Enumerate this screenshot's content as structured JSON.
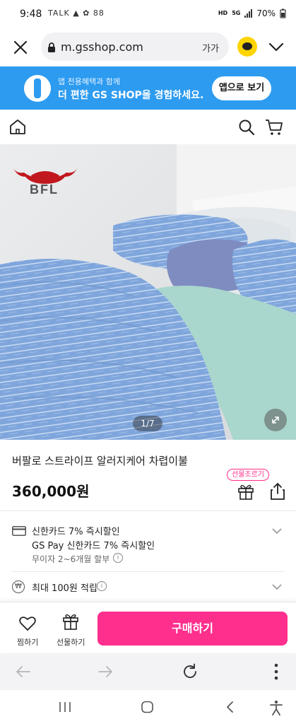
{
  "status_bar": {
    "time": "9:48",
    "left_icons_text": "TALK ▲ ✿ 88",
    "hd_label": "HD",
    "net_label": "5G",
    "battery": "70%"
  },
  "browser": {
    "url": "m.gsshop.com",
    "text_size_label": "가가"
  },
  "app_banner": {
    "line1": "앱 전용혜택과 함께",
    "line2": "더 편한 GS SHOP을 경험하세요.",
    "button_label": "앱으로 보기"
  },
  "product": {
    "brand": "BFL",
    "image_counter": "1/7",
    "title": "버팔로 스트라이프 알러지케어 차렵이불",
    "price": "360,000원",
    "gift_badge": "선물조르기"
  },
  "benefits": {
    "card_line1": "신한카드 7% 즉시할인",
    "card_line2": "GS Pay 신한카드 7% 즉시할인",
    "installment": "무이자 2~6개월 할부",
    "points": "최대 100원 적립",
    "info_glyph": "i",
    "won_glyph": "₩"
  },
  "buy_bar": {
    "wish_label": "찜하기",
    "gift_label": "선물하기",
    "buy_label": "구매하기"
  },
  "colors": {
    "banner_blue": "#2d9bf0",
    "accent_pink": "#ff2f8e",
    "kakao_yellow": "#ffd400"
  }
}
